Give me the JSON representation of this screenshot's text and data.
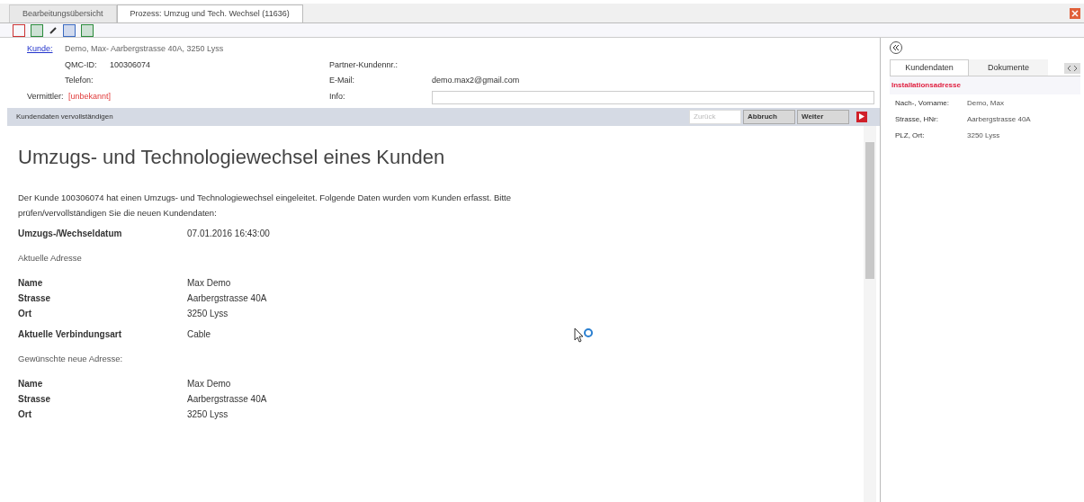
{
  "tabs": [
    {
      "label": "Bearbeitungsübersicht",
      "selected": false
    },
    {
      "label": "Prozess: Umzug und Tech. Wechsel (11636)",
      "selected": true
    }
  ],
  "customer": {
    "kunde_label": "Kunde:",
    "kunde_value": "Demo, Max- Aarbergstrasse 40A, 3250 Lyss",
    "rows": [
      {
        "label": "QMC-ID:",
        "value": "100306074",
        "label2": "Partner-Kundennr.:",
        "value2": ""
      },
      {
        "label": "Telefon:",
        "value": "",
        "label2": "E-Mail:",
        "value2": "demo.max2@gmail.com"
      }
    ],
    "vermittler_label": "Vermittler:",
    "vermittler_value": "[unbekannt]",
    "info_label": "Info:"
  },
  "section": {
    "title": "Kundendaten vervollständigen",
    "buttons": [
      {
        "label": "Zurück",
        "disabled": true
      },
      {
        "label": "Abbruch",
        "disabled": false
      },
      {
        "label": "Weiter",
        "disabled": false
      }
    ]
  },
  "content": {
    "heading": "Umzugs- und Technologiewechsel eines Kunden",
    "intro": "Der Kunde 100306074 hat einen Umzugs- und Technologiewechsel eingeleitet. Folgende Daten wurden vom Kunden erfasst. Bitte prüfen/vervollständigen Sie die neuen Kundendaten:",
    "blocks": [
      {
        "kind": "fields",
        "rows": [
          {
            "label": "Umzugs-/Wechseldatum",
            "value": "07.01.2016 16:43:00"
          }
        ]
      },
      {
        "kind": "subheading",
        "text": "Aktuelle Adresse"
      },
      {
        "kind": "fields",
        "rows": [
          {
            "label": "Name",
            "value": "Max Demo"
          },
          {
            "label": "Strasse",
            "value": "Aarbergstrasse 40A"
          },
          {
            "label": "Ort",
            "value": "3250 Lyss"
          }
        ]
      },
      {
        "kind": "fields",
        "rows": [
          {
            "label": "Aktuelle Verbindungsart",
            "value": "Cable"
          }
        ]
      },
      {
        "kind": "subheading",
        "text": "Gewünschte neue Adresse:"
      },
      {
        "kind": "fields",
        "rows": [
          {
            "label": "Name",
            "value": "Max Demo"
          },
          {
            "label": "Strasse",
            "value": "Aarbergstrasse 40A"
          },
          {
            "label": "Ort",
            "value": "3250 Lyss"
          }
        ]
      }
    ]
  },
  "side_panel": {
    "tabs": [
      {
        "label": "Kundendaten",
        "selected": true
      },
      {
        "label": "Dokumente",
        "selected": false
      }
    ],
    "section_title": "Installationsadresse",
    "rows": [
      {
        "label": "Nach-, Vorname:",
        "value": "Demo, Max"
      },
      {
        "label": "Strasse, HNr:",
        "value": "Aarbergstrasse 40A"
      },
      {
        "label": "PLZ, Ort:",
        "value": "3250 Lyss"
      }
    ]
  }
}
